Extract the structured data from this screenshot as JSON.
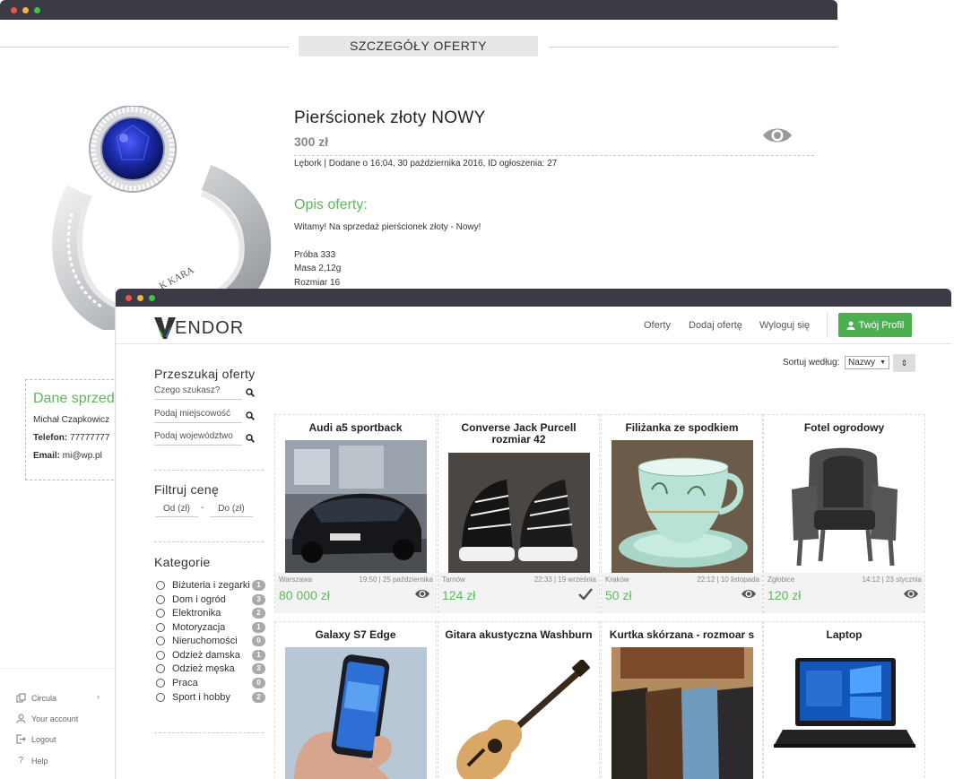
{
  "detail": {
    "section_title": "SZCZEGÓŁY OFERTY",
    "title": "Pierścionek złoty NOWY",
    "price": "300 zł",
    "meta": "Lębork | Dodane o 16:04, 30 października 2016, ID ogłoszenia: 27",
    "desc_heading": "Opis oferty:",
    "desc_lines": [
      "Witamy! Na sprzedaż pierścionek złoty - Nowy!",
      "Próba 333",
      "Masa 2,12g",
      "Rozmiar 16"
    ],
    "ring_engraving": "K KARA"
  },
  "seller": {
    "heading": "Dane sprzed",
    "name": "Michał Czapkowicz",
    "phone_label": "Telefon:",
    "phone": "77777777",
    "email_label": "Email:",
    "email": "mi@wp.pl"
  },
  "side_nav": [
    {
      "label": "Circula",
      "icon": "copy-icon"
    },
    {
      "label": "Your account",
      "icon": "user-icon"
    },
    {
      "label": "Logout",
      "icon": "logout-icon"
    },
    {
      "label": "Help",
      "icon": "help-icon"
    }
  ],
  "vendor": {
    "logo_text": "ENDOR",
    "nav": [
      "Oferty",
      "Dodaj ofertę",
      "Wyloguj się"
    ],
    "profile_button": "Twój Profil",
    "sort_label": "Sortuj według:",
    "sort_value": "Nazwy"
  },
  "filters": {
    "search_heading": "Przeszukaj oferty",
    "search_placeholders": [
      "Czego szukasz?",
      "Podaj miejscowość",
      "Podaj województwo"
    ],
    "price_heading": "Filtruj cenę",
    "price_from": "Od (zł)",
    "price_dash": "-",
    "price_to": "Do (zł)",
    "categories_heading": "Kategorie",
    "categories": [
      {
        "label": "Biżuteria i zegarki",
        "count": "1"
      },
      {
        "label": "Dom i ogród",
        "count": "3"
      },
      {
        "label": "Elektronika",
        "count": "2"
      },
      {
        "label": "Motoryzacja",
        "count": "1"
      },
      {
        "label": "Nieruchomości",
        "count": "0"
      },
      {
        "label": "Odzież damska",
        "count": "1"
      },
      {
        "label": "Odzież męska",
        "count": "3"
      },
      {
        "label": "Praca",
        "count": "0"
      },
      {
        "label": "Sport i hobby",
        "count": "2"
      }
    ]
  },
  "listings": [
    {
      "title": "Audi a5 sportback",
      "location": "Warszawa",
      "date": "19:50 | 25 października",
      "price": "80 000 zł",
      "status_icon": "eye-icon"
    },
    {
      "title": "Converse Jack Purcell rozmiar 42",
      "location": "Tarnów",
      "date": "22:33 | 19 września",
      "price": "124 zł",
      "status_icon": "check-icon"
    },
    {
      "title": "Filiżanka ze spodkiem",
      "location": "Kraków",
      "date": "22:12 | 10 listopada",
      "price": "50 zł",
      "status_icon": "eye-icon"
    },
    {
      "title": "Fotel ogrodowy",
      "location": "Zgłobice",
      "date": "14:12 | 23 stycznia",
      "price": "120 zł",
      "status_icon": "eye-icon"
    },
    {
      "title": "Galaxy S7 Edge"
    },
    {
      "title": "Gitara akustyczna Washburn"
    },
    {
      "title": "Kurtka skórzana - rozmoar s"
    },
    {
      "title": "Laptop"
    }
  ]
}
